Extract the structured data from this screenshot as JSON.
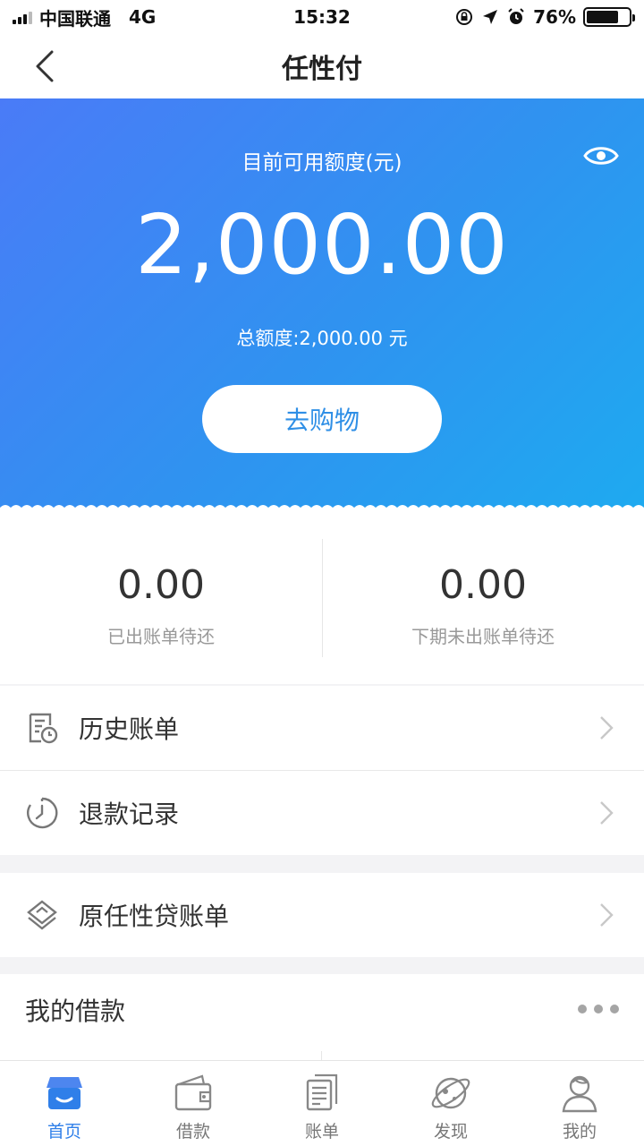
{
  "status_bar": {
    "carrier": "中国联通",
    "network": "4G",
    "time": "15:32",
    "battery": "76%",
    "battery_level": 0.76
  },
  "nav": {
    "title": "任性付",
    "back_icon": "chevron-left-icon"
  },
  "hero": {
    "label": "目前可用额度(元)",
    "amount": "2,000.00",
    "total": "总额度:2,000.00 元",
    "shop_button": "去购物",
    "eye_icon": "eye-icon",
    "colors": {
      "gradient_start": "#4a7bf7",
      "gradient_end": "#1eaaf0"
    }
  },
  "summary": [
    {
      "value": "0.00",
      "label": "已出账单待还"
    },
    {
      "value": "0.00",
      "label": "下期未出账单待还"
    }
  ],
  "rows": [
    {
      "label": "历史账单",
      "icon": "history-bill-icon"
    },
    {
      "label": "退款记录",
      "icon": "clock-icon"
    },
    {
      "label": "原任性贷账单",
      "icon": "layers-icon"
    }
  ],
  "loans": {
    "title": "我的借款",
    "more_icon": "more-dots-icon"
  },
  "tabs": [
    {
      "label": "首页",
      "icon": "shop-icon",
      "active": true
    },
    {
      "label": "借款",
      "icon": "wallet-icon",
      "active": false
    },
    {
      "label": "账单",
      "icon": "bill-icon",
      "active": false
    },
    {
      "label": "发现",
      "icon": "planet-icon",
      "active": false
    },
    {
      "label": "我的",
      "icon": "user-icon",
      "active": false
    }
  ],
  "accent_color": "#2f7fe9"
}
